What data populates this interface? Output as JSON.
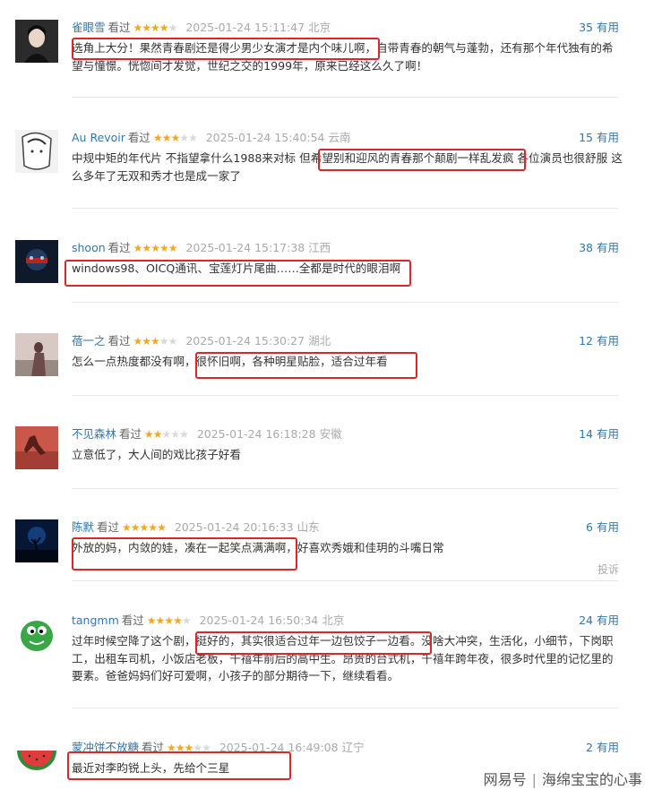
{
  "reviews": [
    {
      "user": "雀眼雪",
      "watched": "看过",
      "stars": "★★★★",
      "stars_off": "★",
      "time": "2025-01-24 15:11:47",
      "loc": "北京",
      "votes": "35",
      "useful": "有用",
      "text": "选角上大分！果然青春剧还是得少男少女演才是内个味儿啊，自带青春的朝气与蓬勃，还有那个年代独有的希望与憧憬。恍惚间才发觉，世纪之交的1999年，原来已经这么久了啊！"
    },
    {
      "user": "Au Revoir",
      "watched": "看过",
      "stars": "★★★",
      "stars_off": "★★",
      "time": "2025-01-24 15:40:54",
      "loc": "云南",
      "votes": "15",
      "useful": "有用",
      "text": "中规中矩的年代片 不指望拿什么1988来对标 但希望别和迎风的青春那个颠剧一样乱发疯 各位演员也很舒服 这么多年了无双和秀才也是成一家了"
    },
    {
      "user": "shoon",
      "watched": "看过",
      "stars": "★★★★★",
      "stars_off": "",
      "time": "2025-01-24 15:17:38",
      "loc": "江西",
      "votes": "38",
      "useful": "有用",
      "text": "windows98、OICQ通讯、宝莲灯片尾曲……全都是时代的眼泪啊"
    },
    {
      "user": "蓓一之",
      "watched": "看过",
      "stars": "★★★",
      "stars_off": "★★",
      "time": "2025-01-24 15:30:27",
      "loc": "湖北",
      "votes": "12",
      "useful": "有用",
      "text": "怎么一点热度都没有啊，很怀旧啊，各种明星贴脸，适合过年看"
    },
    {
      "user": "不见森林",
      "watched": "看过",
      "stars": "★★",
      "stars_off": "★★★",
      "time": "2025-01-24 16:18:28",
      "loc": "安徽",
      "votes": "14",
      "useful": "有用",
      "text": "立意低了，大人间的戏比孩子好看"
    },
    {
      "user": "陈默",
      "watched": "看过",
      "stars": "★★★★★",
      "stars_off": "",
      "time": "2025-01-24 20:16:33",
      "loc": "山东",
      "votes": "6",
      "useful": "有用",
      "text": "外放的妈，内敛的娃，凑在一起笑点满满啊，好喜欢秀娥和佳玥的斗嘴日常",
      "report": "投诉"
    },
    {
      "user": "tangmm",
      "watched": "看过",
      "stars": "★★★★",
      "stars_off": "★",
      "time": "2025-01-24 16:50:34",
      "loc": "北京",
      "votes": "24",
      "useful": "有用",
      "text": "过年时候空降了这个剧，挺好的，其实很适合过年一边包饺子一边看。没啥大冲突，生活化，小细节，下岗职工，出租车司机，小饭店老板，千禧年前后的高中生。昂贵的台式机，千禧年跨年夜，很多时代里的记忆里的要素。爸爸妈妈们好可爱啊，小孩子的部分期待一下，继续看看。"
    },
    {
      "user": "蒙冲饼不放糖",
      "watched": "看过",
      "stars": "★★★",
      "stars_off": "★★",
      "time": "2025-01-24 16:49:08",
      "loc": "辽宁",
      "votes": "2",
      "useful": "有用",
      "text": "最近对李昀锐上头，先给个三星"
    }
  ],
  "watermark": {
    "brand": "网易号",
    "account": "海绵宝宝的心事"
  },
  "colors": {
    "link": "#3377aa",
    "star": "#f5a623",
    "highlight": "#d62a2a"
  }
}
